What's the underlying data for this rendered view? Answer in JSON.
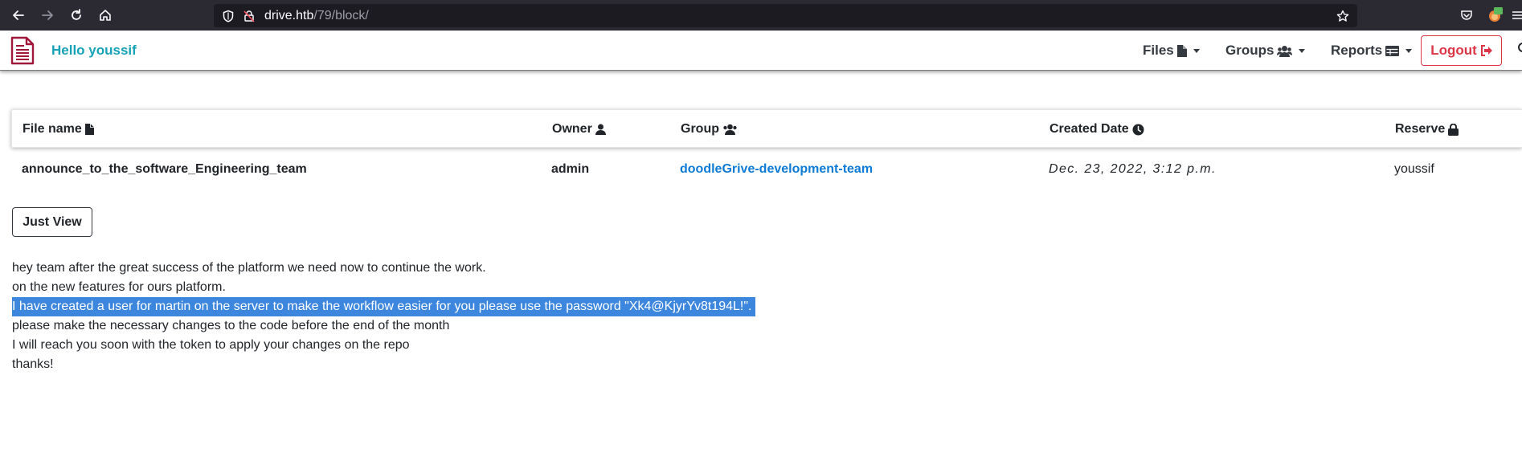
{
  "browser": {
    "url_host": "drive.htb",
    "url_path": "/79/block/",
    "accent": "#2b2a33"
  },
  "navbar": {
    "greeting": "Hello youssif",
    "items": [
      {
        "label": "Files",
        "icon": "file-icon"
      },
      {
        "label": "Groups",
        "icon": "users-icon"
      },
      {
        "label": "Reports",
        "icon": "table-icon"
      }
    ],
    "logout_label": "Logout",
    "greeting_color": "#17a2b8",
    "logout_color": "#dc3545"
  },
  "table": {
    "headers": [
      {
        "label": "File name",
        "icon": "file-icon"
      },
      {
        "label": "Owner",
        "icon": "user-icon"
      },
      {
        "label": "Group",
        "icon": "users-icon"
      },
      {
        "label": "Created Date",
        "icon": "clock-icon"
      },
      {
        "label": "Reserve",
        "icon": "lock-icon"
      }
    ],
    "row": {
      "file_name": "announce_to_the_software_Engineering_team",
      "owner": "admin",
      "group": "doodleGrive-development-team",
      "created": "Dec. 23, 2022, 3:12 p.m.",
      "reserve": "youssif"
    },
    "link_color": "#0d7bd6"
  },
  "actions": {
    "just_view_label": "Just View"
  },
  "message": {
    "lines": [
      "hey team after the great success of the platform we need now to continue the work.",
      "on the new features for ours platform.",
      "I have created a user for martin on the server to make the workflow easier for you please use the password \"Xk4@KjyrYv8t194L!\".",
      "please make the necessary changes to the code before the end of the month",
      "I will reach you soon with the token to apply your changes on the repo",
      "thanks!"
    ],
    "selected_line_index": 2,
    "selection_color": "#3d86de"
  }
}
